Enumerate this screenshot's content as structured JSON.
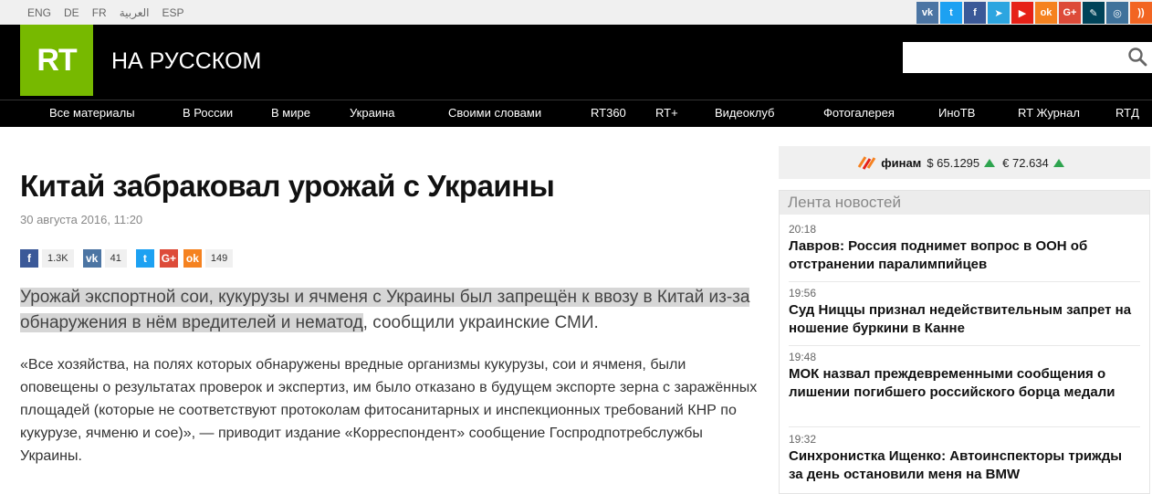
{
  "langs": [
    "ENG",
    "DE",
    "FR",
    "العربية",
    "ESP"
  ],
  "social": [
    {
      "icon": "vk-icon",
      "glyph": "vk",
      "color": "#4c75a3"
    },
    {
      "icon": "twitter-icon",
      "glyph": "t",
      "color": "#1da1f2"
    },
    {
      "icon": "facebook-icon",
      "glyph": "f",
      "color": "#3b5998"
    },
    {
      "icon": "telegram-icon",
      "glyph": "➤",
      "color": "#2ca5e0"
    },
    {
      "icon": "youtube-icon",
      "glyph": "▶",
      "color": "#e62117"
    },
    {
      "icon": "odnoklassniki-icon",
      "glyph": "ok",
      "color": "#f58220"
    },
    {
      "icon": "google-plus-icon",
      "glyph": "G+",
      "color": "#dd4b39"
    },
    {
      "icon": "livejournal-icon",
      "glyph": "✎",
      "color": "#004359"
    },
    {
      "icon": "instagram-icon",
      "glyph": "◎",
      "color": "#3f729b"
    },
    {
      "icon": "rss-icon",
      "glyph": "))",
      "color": "#f26522"
    }
  ],
  "header": {
    "logo": "RT",
    "site_name": "НА РУССКОМ",
    "search_placeholder": ""
  },
  "nav": [
    "Все материалы",
    "В России",
    "В мире",
    "Украина",
    "Своими словами",
    "RT360",
    "RT+",
    "Видеоклуб",
    "Фотогалерея",
    "ИноТВ",
    "RT Журнал",
    "RTД"
  ],
  "article": {
    "title": "Китай забраковал урожай с Украины",
    "date": "30 августа 2016, 11:20",
    "shares": [
      {
        "icon": "facebook-icon",
        "glyph": "f",
        "color": "#3b5998",
        "count": "1.3K"
      },
      {
        "icon": "vk-icon",
        "glyph": "vk",
        "color": "#4c75a3",
        "count": "41"
      },
      {
        "icon": "twitter-icon",
        "glyph": "t",
        "color": "#1da1f2",
        "count": ""
      },
      {
        "icon": "google-plus-icon",
        "glyph": "G+",
        "color": "#dd4b39",
        "count": ""
      },
      {
        "icon": "odnoklassniki-icon",
        "glyph": "ok",
        "color": "#f58220",
        "count": "149"
      }
    ],
    "lead_highlighted": "Урожай экспортной сои, кукурузы и ячменя с Украины был запрещён к ввозу в Китай из-за обнаружения в нём вредителей и нематод",
    "lead_rest": ", сообщили украинские СМИ.",
    "body": "«Все хозяйства, на полях которых обнаружены вредные организмы кукурузы, сои и ячменя, были оповещены о результатах проверок и экспертиз, им было отказано в будущем экспорте зерна с заражённых площадей (которые не соответствуют протоколам фитосанитарных и инспекционных требований КНР по кукурузе, ячменю и сое)», — приводит издание «Корреспондент» сообщение Госпродпотребслужбы Украины."
  },
  "rates": {
    "brand": "финам",
    "usd": "$ 65.1295",
    "eur": "€ 72.634",
    "up_color": "#2ea44f"
  },
  "feed": {
    "title": "Лента новостей",
    "items": [
      {
        "time": "20:18",
        "title": "Лавров: Россия поднимет вопрос в ООН об отстранении паралимпийцев"
      },
      {
        "time": "19:56",
        "title": "Суд Ниццы признал недействительным запрет на ношение буркини в Канне"
      },
      {
        "time": "19:48",
        "title": "МОК назвал преждевременными сообщения о лишении погибшего российского борца медали"
      },
      {
        "time": "19:32",
        "title": "Синхронистка Ищенко: Автоинспекторы трижды за день остановили меня на BMW"
      }
    ]
  }
}
